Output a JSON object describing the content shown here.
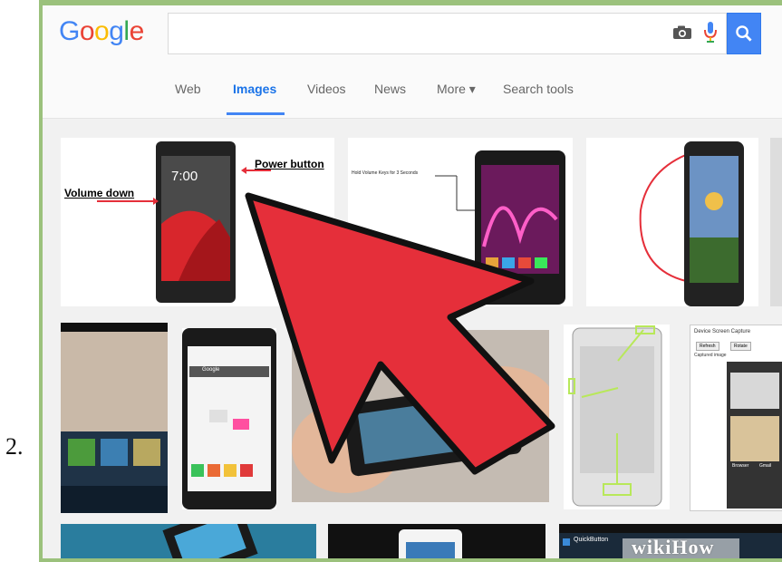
{
  "step": {
    "number": "2."
  },
  "logo": {
    "letters": [
      "G",
      "o",
      "o",
      "g",
      "l",
      "e"
    ],
    "colors": [
      "#4285f4",
      "#ea4335",
      "#fbbc05",
      "#4285f4",
      "#34a853",
      "#ea4335"
    ]
  },
  "search": {
    "query": "",
    "placeholder": ""
  },
  "tabs": [
    {
      "label": "Web",
      "active": false
    },
    {
      "label": "Images",
      "active": true
    },
    {
      "label": "Videos",
      "active": false
    },
    {
      "label": "News",
      "active": false
    },
    {
      "label": "More ▾",
      "active": false
    },
    {
      "label": "Search tools",
      "active": false
    }
  ],
  "images": {
    "tile1": {
      "power": "Power button",
      "volume": "Volume down",
      "time": "7:00"
    },
    "tile2": {
      "caption": "Hold Volume Keys for 3 Seconds"
    },
    "tile5": {
      "search_label": "Google"
    },
    "tile8": {
      "title": "Device Screen Capture",
      "btn1": "Refresh",
      "btn2": "Rotate",
      "sub": "Captured image",
      "app1": "Browser",
      "app2": "Gmail"
    },
    "tile10": {
      "label": "QuickButton"
    }
  },
  "watermark": {
    "text": "wikiHow"
  },
  "colors": {
    "accent": "#4285f4",
    "frame": "#9bc17c",
    "arrow": "#e52f3a"
  }
}
